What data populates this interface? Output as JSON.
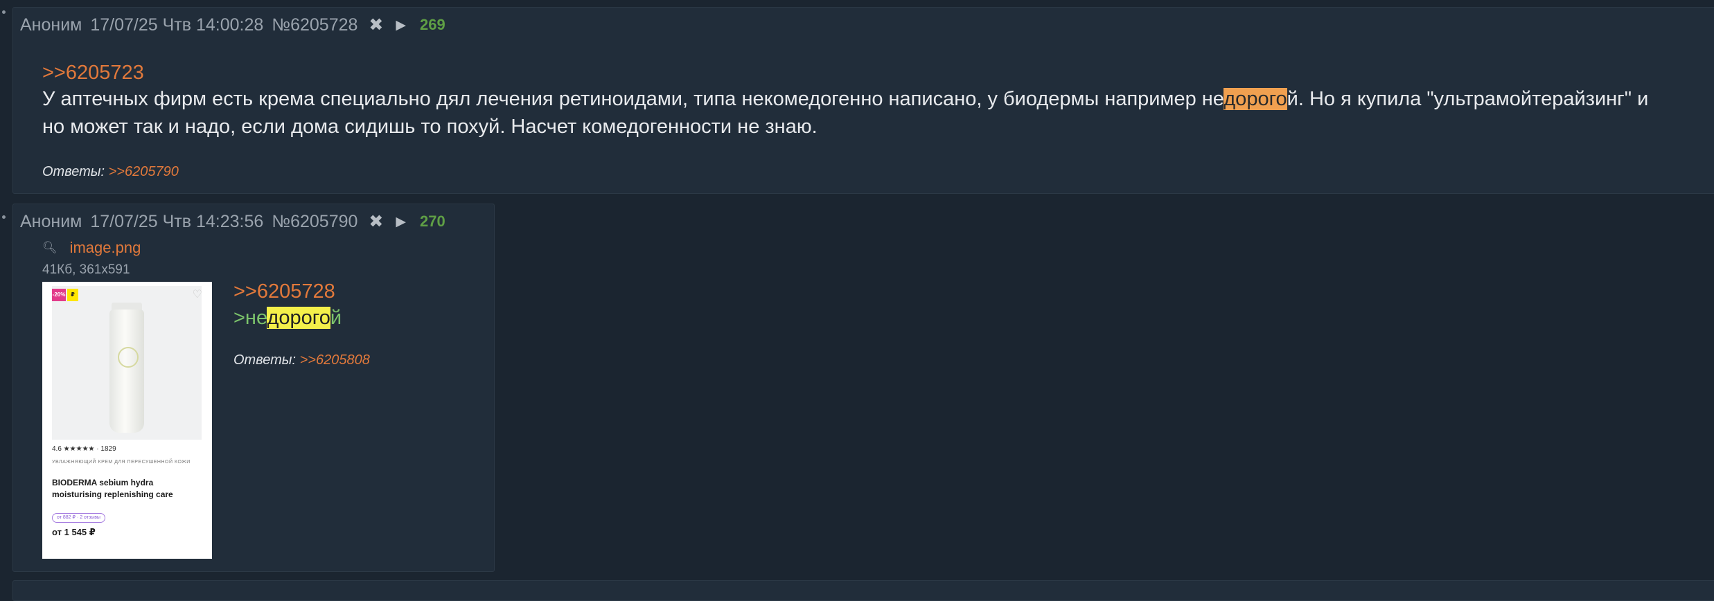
{
  "post1": {
    "author": "Аноним",
    "date": "17/07/25 Чтв 14:00:28",
    "id": "№6205728",
    "number": "269",
    "reply_link": ">>6205723",
    "line1_before": "У аптечных фирм есть крема специально дял лечения ретиноидами, типа некомедогенно написано, у биодермы например не",
    "line1_highlight": "дорого",
    "line1_after": "й. Но я купила \"ультрамойтерайзинг\" и",
    "line2": "но может так и надо, если дома сидишь то похуй. Насчет комедогенности не знаю.",
    "replies_label": "Ответы:",
    "replies_link": ">>6205790"
  },
  "post2": {
    "author": "Аноним",
    "date": "17/07/25 Чтв 14:23:56",
    "id": "№6205790",
    "number": "270",
    "file_name": "image.png",
    "file_meta": "41Кб, 361x591",
    "reply_link": ">>6205728",
    "green_before": ">не",
    "green_highlight": "дорого",
    "green_after": "й",
    "replies_label": "Ответы:",
    "replies_link": ">>6205808"
  },
  "thumbnail": {
    "badge1": "-20%",
    "badge2": "₽",
    "rating": "4.6 ★★★★★ · 1829",
    "category": "УВЛАЖНЯЮЩИЙ КРЕМ ДЛЯ ПЕРЕСУШЕННОЙ КОЖИ",
    "title": "BIODERMA sebium hydra moisturising replenishing care",
    "pill": "от 882 ₽ · 2 отзывы",
    "price": "от 1 545 ₽"
  },
  "icons": {
    "hide": "close-icon",
    "play": "play-icon",
    "search": "magnifier-icon",
    "heart": "heart-icon"
  },
  "colors": {
    "link": "#e2793b",
    "post_number": "#5f9f45",
    "greentext": "#7cc46b",
    "highlight_orange": "#f0a050",
    "highlight_yellow": "#f4f04a"
  }
}
